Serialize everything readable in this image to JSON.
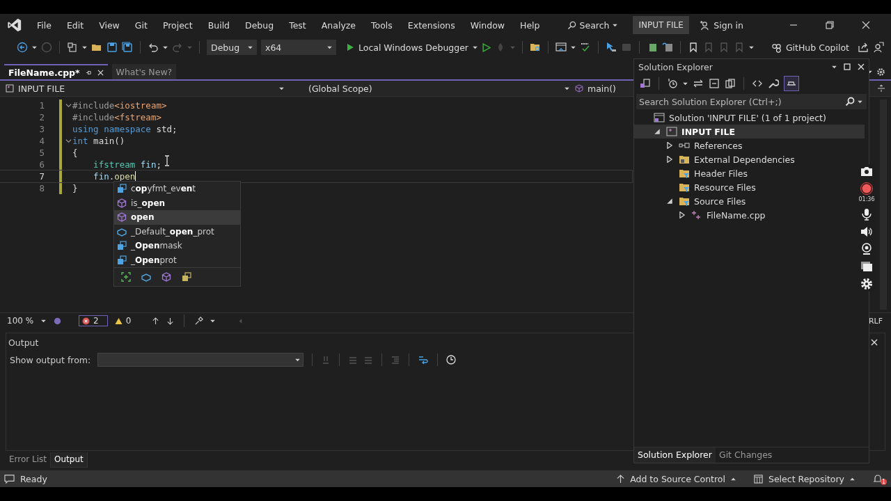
{
  "menu": [
    {
      "label": "File"
    },
    {
      "label": "Edit"
    },
    {
      "label": "View"
    },
    {
      "label": "Git"
    },
    {
      "label": "Project"
    },
    {
      "label": "Build"
    },
    {
      "label": "Debug"
    },
    {
      "label": "Test"
    },
    {
      "label": "Analyze"
    },
    {
      "label": "Tools"
    },
    {
      "label": "Extensions"
    },
    {
      "label": "Window"
    },
    {
      "label": "Help"
    }
  ],
  "search": {
    "label": "Search"
  },
  "solution_badge": "INPUT FILE",
  "sign_in": "Sign in",
  "toolbar": {
    "configuration": "Debug",
    "platform": "x64",
    "debugger": "Local Windows Debugger",
    "copilot": "GitHub Copilot"
  },
  "editor_tabs": [
    {
      "label": "FileName.cpp*",
      "selected": true
    },
    {
      "label": "What's New?",
      "selected": false
    }
  ],
  "nav_bar": {
    "project": "INPUT FILE",
    "scope": "(Global Scope)",
    "member": "main()"
  },
  "code": [
    {
      "number": "1",
      "fold": true,
      "current": false,
      "tokens": [
        {
          "text": "#include",
          "kind": "preproc"
        },
        {
          "text": "<iostream>",
          "kind": "string"
        }
      ]
    },
    {
      "number": "2",
      "fold": false,
      "current": false,
      "tokens": [
        {
          "text": "#include",
          "kind": "preproc"
        },
        {
          "text": "<fstream>",
          "kind": "string"
        }
      ]
    },
    {
      "number": "3",
      "fold": false,
      "current": false,
      "tokens": [
        {
          "text": "using",
          "kind": "keyword"
        },
        {
          "text": " namespace",
          "kind": "keyword"
        },
        {
          "text": " std;",
          "kind": "plain"
        }
      ]
    },
    {
      "number": "4",
      "fold": true,
      "current": false,
      "tokens": [
        {
          "text": "int",
          "kind": "keyword"
        },
        {
          "text": " main()",
          "kind": "plain"
        }
      ]
    },
    {
      "number": "5",
      "fold": false,
      "current": false,
      "tokens": [
        {
          "text": "{",
          "kind": "plain"
        }
      ]
    },
    {
      "number": "6",
      "fold": false,
      "current": false,
      "tokens": [
        {
          "text": "    ifstream",
          "kind": "type"
        },
        {
          "text": " fin",
          "kind": "variable"
        },
        {
          "text": ";",
          "kind": "plain"
        }
      ]
    },
    {
      "number": "7",
      "fold": false,
      "current": true,
      "tokens": [
        {
          "text": "    fin",
          "kind": "variable"
        },
        {
          "text": ".",
          "kind": "plain"
        },
        {
          "text": "open",
          "kind": "function"
        }
      ]
    },
    {
      "number": "8",
      "fold": false,
      "current": false,
      "tokens": [
        {
          "text": "}",
          "kind": "plain"
        }
      ]
    }
  ],
  "completion": [
    {
      "text": "c**op**yfmt_ev**en**t",
      "kind": "enum",
      "selected": false
    },
    {
      "text": "is_**open**",
      "kind": "method",
      "selected": false
    },
    {
      "text": "open",
      "kind": "method",
      "selected": true
    },
    {
      "text": "_Default_**open**_prot",
      "kind": "struct",
      "selected": false
    },
    {
      "text": "_**Open**mask",
      "kind": "enum",
      "selected": false
    },
    {
      "text": "_**Open**prot",
      "kind": "enum",
      "selected": false
    }
  ],
  "editor_status": {
    "zoom": "100 %",
    "errors": "2",
    "warnings": "0",
    "line_ending": "RLF"
  },
  "output": {
    "title": "Output",
    "source_label": "Show output from:"
  },
  "bottom_tabs": [
    {
      "label": "Error List",
      "selected": false
    },
    {
      "label": "Output",
      "selected": true
    }
  ],
  "solution_explorer": {
    "title": "Solution Explorer",
    "search_placeholder": "Search Solution Explorer (Ctrl+;)",
    "tree": [
      {
        "label": "Solution 'INPUT FILE' (1 of 1 project)",
        "kind": "solution",
        "expandable": false,
        "expanded": true,
        "selected": false,
        "children": [
          {
            "label": "INPUT FILE",
            "kind": "project",
            "expandable": true,
            "expanded": true,
            "selected": true,
            "children": [
              {
                "label": "References",
                "kind": "references",
                "expandable": true,
                "expanded": false,
                "selected": false
              },
              {
                "label": "External Dependencies",
                "kind": "dependencies",
                "expandable": true,
                "expanded": false,
                "selected": false
              },
              {
                "label": "Header Files",
                "kind": "filter",
                "expandable": false,
                "selected": false
              },
              {
                "label": "Resource Files",
                "kind": "filter",
                "expandable": false,
                "selected": false
              },
              {
                "label": "Source Files",
                "kind": "filter",
                "expandable": true,
                "expanded": true,
                "selected": false,
                "children": [
                  {
                    "label": "FileName.cpp",
                    "kind": "cpp",
                    "expandable": true,
                    "expanded": false,
                    "selected": false
                  }
                ]
              }
            ]
          }
        ]
      }
    ],
    "tabs": [
      {
        "label": "Solution Explorer",
        "selected": true
      },
      {
        "label": "Git Changes",
        "selected": false
      }
    ]
  },
  "recorder": {
    "timer": "01:36"
  },
  "status_bar": {
    "state": "Ready",
    "source_control": "Add to Source Control",
    "repository": "Select Repository",
    "notifications": "1"
  }
}
